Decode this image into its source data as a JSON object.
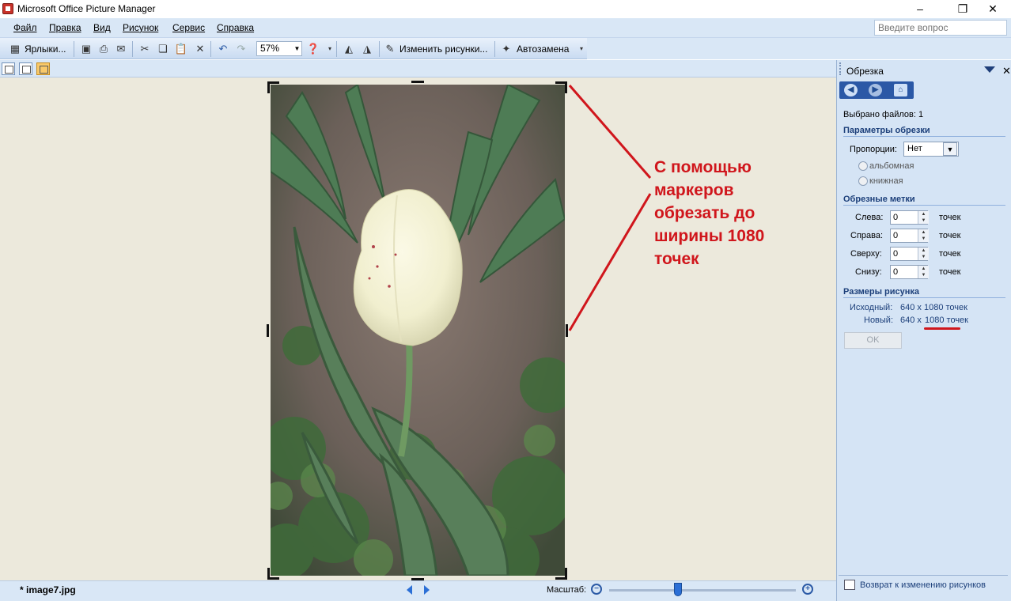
{
  "window": {
    "title": "Microsoft Office Picture Manager",
    "min_glyph": "–",
    "restore_glyph": "❐",
    "close_glyph": "✕"
  },
  "menu": {
    "items": [
      "Файл",
      "Правка",
      "Вид",
      "Рисунок",
      "Сервис",
      "Справка"
    ]
  },
  "search": {
    "placeholder": "Введите вопрос"
  },
  "toolbar": {
    "shortcuts_label": "Ярлыки...",
    "zoom_value": "57%",
    "edit_pictures_label": "Изменить рисунки...",
    "autocorrect_label": "Автозамена"
  },
  "annotation": {
    "text_lines": [
      "С помощью",
      "маркеров",
      "обрезать до",
      "ширины 1080",
      "точек"
    ],
    "color": "#d0161c"
  },
  "panel": {
    "title": "Обрезка",
    "selected_files": "Выбрано файлов: 1",
    "crop_params_heading": "Параметры обрезки",
    "proportions_label": "Пропорции:",
    "proportions_value": "Нет",
    "landscape_label": "альбомная",
    "portrait_label": "книжная",
    "crop_marks_heading": "Обрезные метки",
    "crop_marks": [
      {
        "label": "Слева:",
        "value": "0",
        "unit": "точек"
      },
      {
        "label": "Справа:",
        "value": "0",
        "unit": "точек"
      },
      {
        "label": "Сверху:",
        "value": "0",
        "unit": "точек"
      },
      {
        "label": "Снизу:",
        "value": "0",
        "unit": "точек"
      }
    ],
    "sizes_heading": "Размеры рисунка",
    "original_label": "Исходный:",
    "original_value": "640 x 1080 точек",
    "new_label": "Новый:",
    "new_value_prefix": "640 x",
    "new_value_highlight": "1080 точек",
    "ok_label": "OK",
    "return_link": "Возврат к изменению рисунков"
  },
  "status": {
    "filename": "* image7.jpg",
    "scale_label": "Масштаб:",
    "zoom_slider_fraction": 0.37
  }
}
